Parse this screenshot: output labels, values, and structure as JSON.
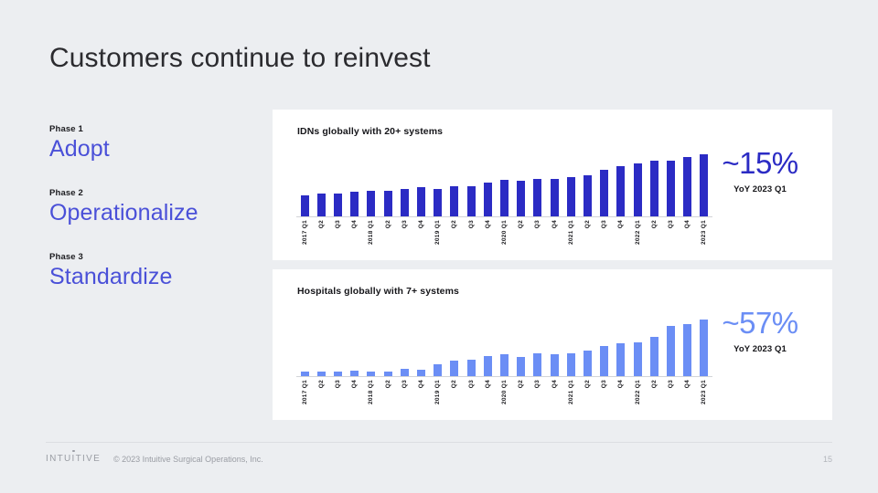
{
  "slide": {
    "title": "Customers continue to reinvest",
    "background_color": "#eceef1"
  },
  "phases": [
    {
      "kicker": "Phase 1",
      "name": "Adopt"
    },
    {
      "kicker": "Phase 2",
      "name": "Operationalize"
    },
    {
      "kicker": "Phase 3",
      "name": "Standardize"
    }
  ],
  "phase_color": "#4a50d8",
  "charts": [
    {
      "id": "idn",
      "heading": "IDNs globally with 20+ systems",
      "callout_value": "~15%",
      "callout_label": "YoY 2023 Q1",
      "callout_color": "#2b2bc4"
    },
    {
      "id": "hospital",
      "heading": "Hospitals globally with 7+ systems",
      "callout_value": "~57%",
      "callout_label": "YoY 2023 Q1",
      "callout_color": "#6b8ef5"
    }
  ],
  "chart_data": [
    {
      "type": "bar",
      "title": "IDNs globally with 20+ systems",
      "xlabel": "",
      "ylabel": "",
      "grid": false,
      "legend": "none",
      "bar_color": "#2b2bc4",
      "annotation": "~15% YoY 2023 Q1",
      "categories": [
        "2017 Q1",
        "Q2",
        "Q3",
        "Q4",
        "2018 Q1",
        "Q2",
        "Q3",
        "Q4",
        "2019 Q1",
        "Q2",
        "Q3",
        "Q4",
        "2020 Q1",
        "Q2",
        "Q3",
        "Q4",
        "2021 Q1",
        "Q2",
        "Q3",
        "Q4",
        "2022 Q1",
        "Q2",
        "Q3",
        "Q4",
        "2023 Q1"
      ],
      "values": [
        30,
        32,
        32,
        35,
        36,
        36,
        39,
        41,
        39,
        43,
        43,
        47,
        51,
        50,
        52,
        52,
        55,
        58,
        65,
        70,
        74,
        77,
        77,
        82,
        86
      ],
      "ylim": [
        0,
        100
      ]
    },
    {
      "type": "bar",
      "title": "Hospitals globally with 7+ systems",
      "xlabel": "",
      "ylabel": "",
      "grid": false,
      "legend": "none",
      "bar_color": "#6b8ef5",
      "annotation": "~57% YoY 2023 Q1",
      "categories": [
        "2017 Q1",
        "Q2",
        "Q3",
        "Q4",
        "2018 Q1",
        "Q2",
        "Q3",
        "Q4",
        "2019 Q1",
        "Q2",
        "Q3",
        "Q4",
        "2020 Q1",
        "Q2",
        "Q3",
        "Q4",
        "2021 Q1",
        "Q2",
        "Q3",
        "Q4",
        "2022 Q1",
        "Q2",
        "Q3",
        "Q4",
        "2023 Q1"
      ],
      "values": [
        7,
        7,
        7,
        9,
        8,
        8,
        11,
        10,
        18,
        22,
        24,
        29,
        31,
        28,
        33,
        31,
        32,
        36,
        42,
        46,
        48,
        55,
        70,
        72,
        79
      ],
      "ylim": [
        0,
        100
      ]
    }
  ],
  "footer": {
    "brand_prefix": "INTU",
    "brand_dot_letter": "I",
    "brand_suffix": "TIVE",
    "copyright": "© 2023 Intuitive Surgical Operations, Inc.",
    "page_number": "15"
  }
}
